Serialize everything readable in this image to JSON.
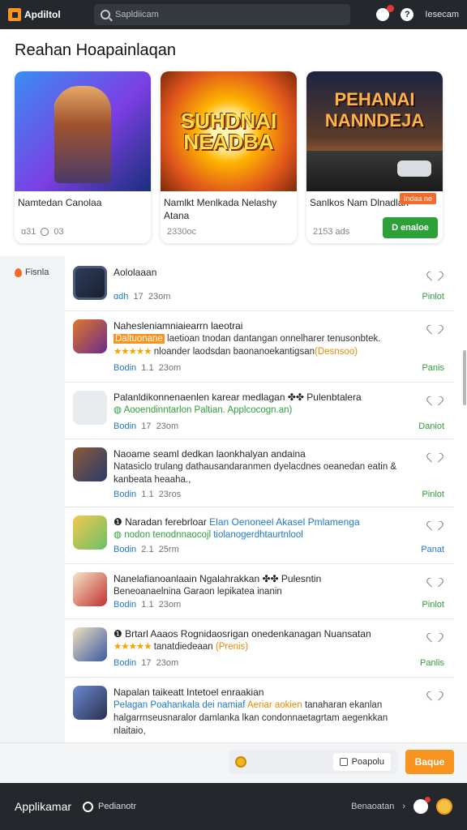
{
  "topbar": {
    "app_name": "Apdiltol",
    "search_placeholder": "Sapldiicam",
    "login_label": "Iesecam",
    "help_label": "?"
  },
  "featured": {
    "title": "Reahan Hoapainlaqan",
    "cards": [
      {
        "name": "Namtedan Canolaa",
        "meta_a": "ɑ31",
        "meta_b": "03"
      },
      {
        "name": "Namlkt Menlkada Nelashy Atana",
        "banner": "SUHDNAI NEADBA",
        "meta_a": "2330oc"
      },
      {
        "name": "Sanlkos Nam Dlnadlan",
        "banner": "PEHANAI NANNDEJA",
        "hot": "Indaa ne",
        "meta_a": "2153 ads",
        "play_label": "D enaloe"
      }
    ]
  },
  "sidebar": {
    "item_label": "Fisnla"
  },
  "list": [
    {
      "title": "Aololaaan",
      "cat": "ɑdh",
      "count": "17",
      "time": "23om",
      "action": "Pinlot"
    },
    {
      "title": "Nahesleniamniaiearrn laeotrai",
      "desc_hl": "Daltuonane",
      "desc_rest": "laetioan tnodan dantangan onnelharer tenusonbtek.",
      "stars": "★★★★★",
      "desc2": "nloander laodsdan baonanoekantigsan",
      "desc2_o": "(Desnsoo)",
      "cat": "Bodin",
      "count": "1.1",
      "time": "23om",
      "action": "Panis"
    },
    {
      "title": "Palanldikonnenaenlen karear medlagan ✤✤ Pulenbtalera",
      "desc_g": "◍ Aooendinntarlon Paltian. Applcocogn.an)",
      "cat": "Bodin",
      "count": "17",
      "time": "23om",
      "action": "Daniot"
    },
    {
      "title": "Naoame seaml dedkan laonkhalyan andaina",
      "desc": "Natasiclo trulang dathausandaranmen dyelacdnes oeanedan eatin & kanbeata heaaha.,",
      "cat": "Bodin",
      "count": "1.1",
      "time": "23ros",
      "action": "Pinlot"
    },
    {
      "title": "❶ Naradan ferebrloar",
      "title_blue": "Elan Oenoneel Akasel Pmlamenga",
      "desc_g": "◍ nodon tenodnnaocojl",
      "desc_b": "tiolanogerdhtaurtnlool",
      "cat": "Bodin",
      "count": "2.1",
      "time": "25rm",
      "action": "Panat"
    },
    {
      "title": "Nanelafianoanlaain Ngalahrakkan ✤✤ Pulesntin",
      "desc": "Beneoanaelnina Garaon lepikatea inanin",
      "cat": "Bodin",
      "count": "1.1",
      "time": "23om",
      "action": "Pinlot"
    },
    {
      "title": "❶ Brtarl Aaaos Rognidaosrigan onedenkanagan Nuansatan",
      "stars": "★★★★★",
      "desc2": "tanatdiedeaan",
      "desc2_o": "(Prenis)",
      "cat": "Bodin",
      "count": "17",
      "time": "23om",
      "action": "Panlis"
    },
    {
      "title": "Napalan taikeatt Intetoel enraakian",
      "desc_b": "Pelagan Poahankala dei namiaf",
      "desc_o": "Aeriar aokien",
      "desc_rest": "tanaharan ekanlan halgarrnseusnaralor damlanka lkan condonnaetagrtam aegenkkan nlaitaio,",
      "cat": "",
      "count": "",
      "time": "",
      "action": ""
    }
  ],
  "actionbar": {
    "pay_label": "Poapolu",
    "buy_label": "Baque"
  },
  "footer": {
    "brand": "Applikamar",
    "link": "Pedianotr",
    "right_text": "Benaoatan"
  },
  "colors": {
    "accent": "#f7931e",
    "green": "#2ea03a",
    "link_blue": "#1e79c8",
    "topbar": "#24272c"
  }
}
